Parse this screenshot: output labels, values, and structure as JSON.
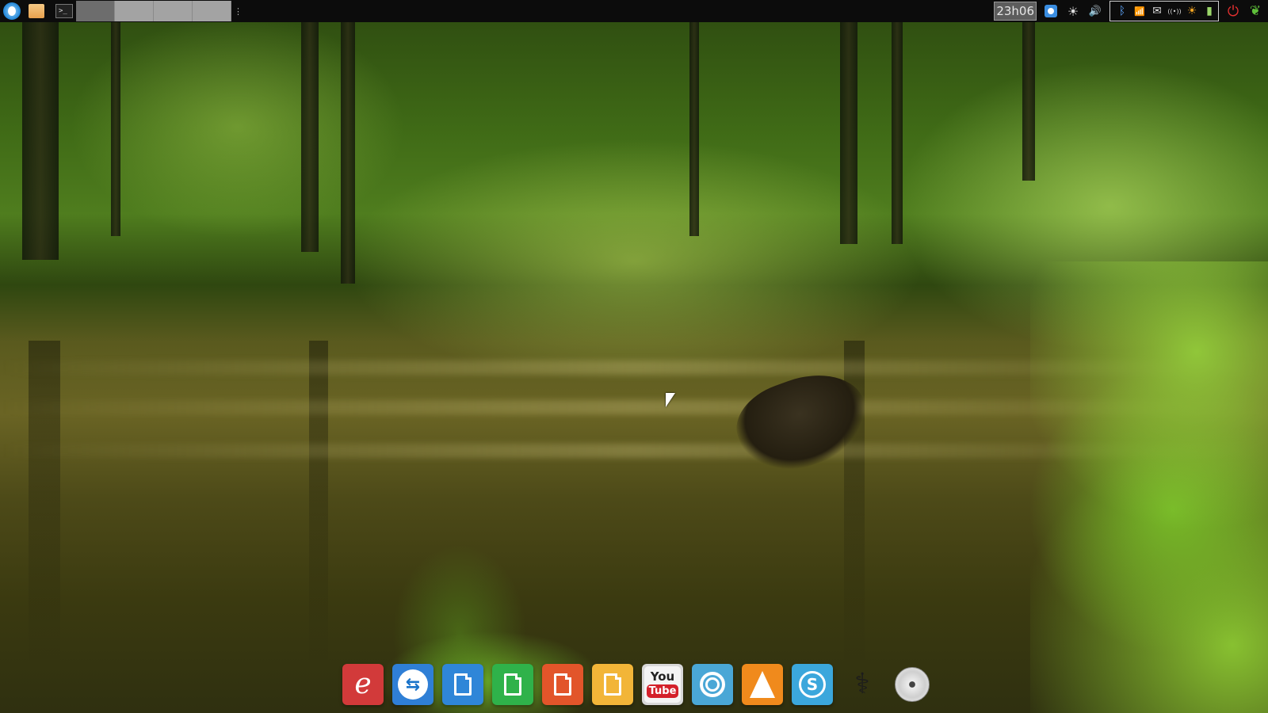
{
  "top_panel": {
    "launchers": [
      {
        "name": "app-menu-icon"
      },
      {
        "name": "file-manager-icon"
      },
      {
        "name": "terminal-icon",
        "glyph": ">_"
      }
    ],
    "workspaces": [
      {
        "active": true
      },
      {
        "active": false
      },
      {
        "active": false
      },
      {
        "active": false
      }
    ],
    "clock": "23h06",
    "tray": {
      "display_icon": "display-settings-icon",
      "brightness_glyph": "☀",
      "volume_glyph": "🔊",
      "bluetooth_glyph": "ᛒ",
      "wifi_glyph": "📶",
      "mail_glyph": "✉",
      "signal_glyph": "((•))",
      "weather_glyph": "☀",
      "battery_glyph": "▮",
      "power_glyph": "⏻",
      "leaf_glyph": "❦"
    }
  },
  "dock": {
    "items": [
      {
        "name": "ebook-reader-app",
        "color": "#d23a3a",
        "glyph": "e"
      },
      {
        "name": "teamviewer-app",
        "color": "#2f7fd6",
        "glyph": "⇆"
      },
      {
        "name": "writer-app",
        "color": "#2f86d8"
      },
      {
        "name": "calc-app",
        "color": "#2fb24a"
      },
      {
        "name": "impress-app",
        "color": "#e2552a"
      },
      {
        "name": "draw-app",
        "color": "#f2b538"
      },
      {
        "name": "youtube-app",
        "you": "You",
        "tube": "Tube"
      },
      {
        "name": "chromium-app",
        "color": "#4aa7d6"
      },
      {
        "name": "vlc-app",
        "color": "#f08a1c"
      },
      {
        "name": "skype-app",
        "color": "#3ba7dc",
        "glyph": "S"
      },
      {
        "name": "stethoscope-app",
        "glyph": "⚕"
      },
      {
        "name": "disc-burner-app"
      }
    ]
  }
}
